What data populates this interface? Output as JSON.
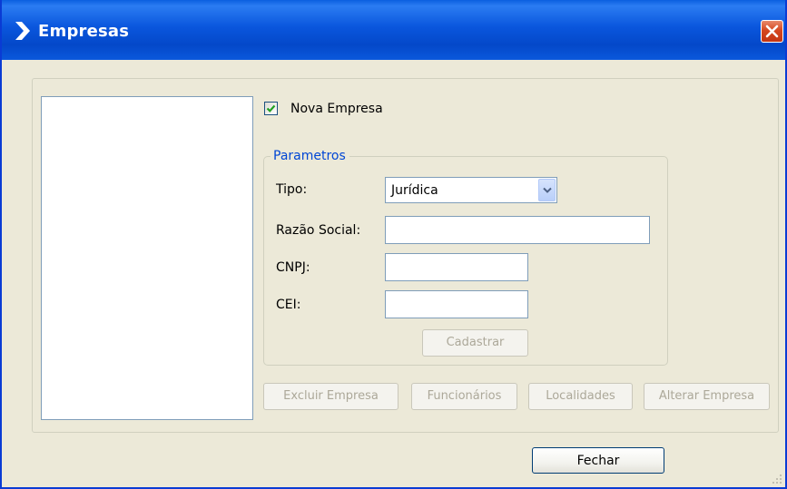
{
  "window": {
    "title": "Empresas",
    "icon": "chevron-right-icon",
    "close_icon": "close-icon"
  },
  "nova_empresa": {
    "label": "Nova Empresa",
    "checked": true
  },
  "parametros": {
    "legend": "Parametros",
    "tipo_label": "Tipo:",
    "tipo_value": "Jurídica",
    "razao_social_label": "Razão Social:",
    "razao_social_value": "",
    "cnpj_label": "CNPJ:",
    "cnpj_value": "",
    "cei_label": "CEI:",
    "cei_value": "",
    "cadastrar_label": "Cadastrar"
  },
  "actions": {
    "excluir_label": "Excluir Empresa",
    "funcionarios_label": "Funcionários",
    "localidades_label": "Localidades",
    "alterar_label": "Alterar Empresa"
  },
  "footer": {
    "fechar_label": "Fechar"
  },
  "colors": {
    "titlebar": "#0a56dd",
    "window_bg": "#ece9d8",
    "group_legend": "#0046d5",
    "disabled_text": "#aca899"
  }
}
